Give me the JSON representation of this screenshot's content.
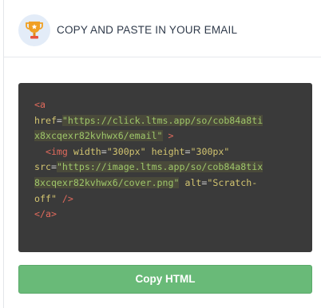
{
  "header": {
    "icon": "trophy-icon",
    "title": "COPY AND PASTE IN YOUR EMAIL",
    "icon_bg": "#e3ecf8",
    "icon_color": "#f0a024"
  },
  "code": {
    "a_open": "<a",
    "href_attr": "href",
    "href_url_1": "\"https://click.ltms.app/so/cob84a8ti",
    "href_url_2": "x8xcqexr82kvhwx6/email\"",
    "a_close_bracket": ">",
    "img_open": "<img",
    "width_attr": "width",
    "width_val": "\"300px\"",
    "height_attr": "height",
    "height_val": "\"300px\"",
    "src_attr": "src",
    "src_url_1": "\"https://image.ltms.app/so/cob84a8tix",
    "src_url_2": "8xcqexr82kvhwx6/cover.png\"",
    "alt_attr": "alt",
    "alt_val_1": "\"Scratch-",
    "alt_val_2": "off\"",
    "img_close": "/>",
    "a_end": "</a>"
  },
  "actions": {
    "copy_label": "Copy HTML"
  },
  "colors": {
    "code_bg": "#3a3a3a",
    "button_bg": "#69ba78",
    "tag": "#e06a5c",
    "string": "#d2c470"
  }
}
